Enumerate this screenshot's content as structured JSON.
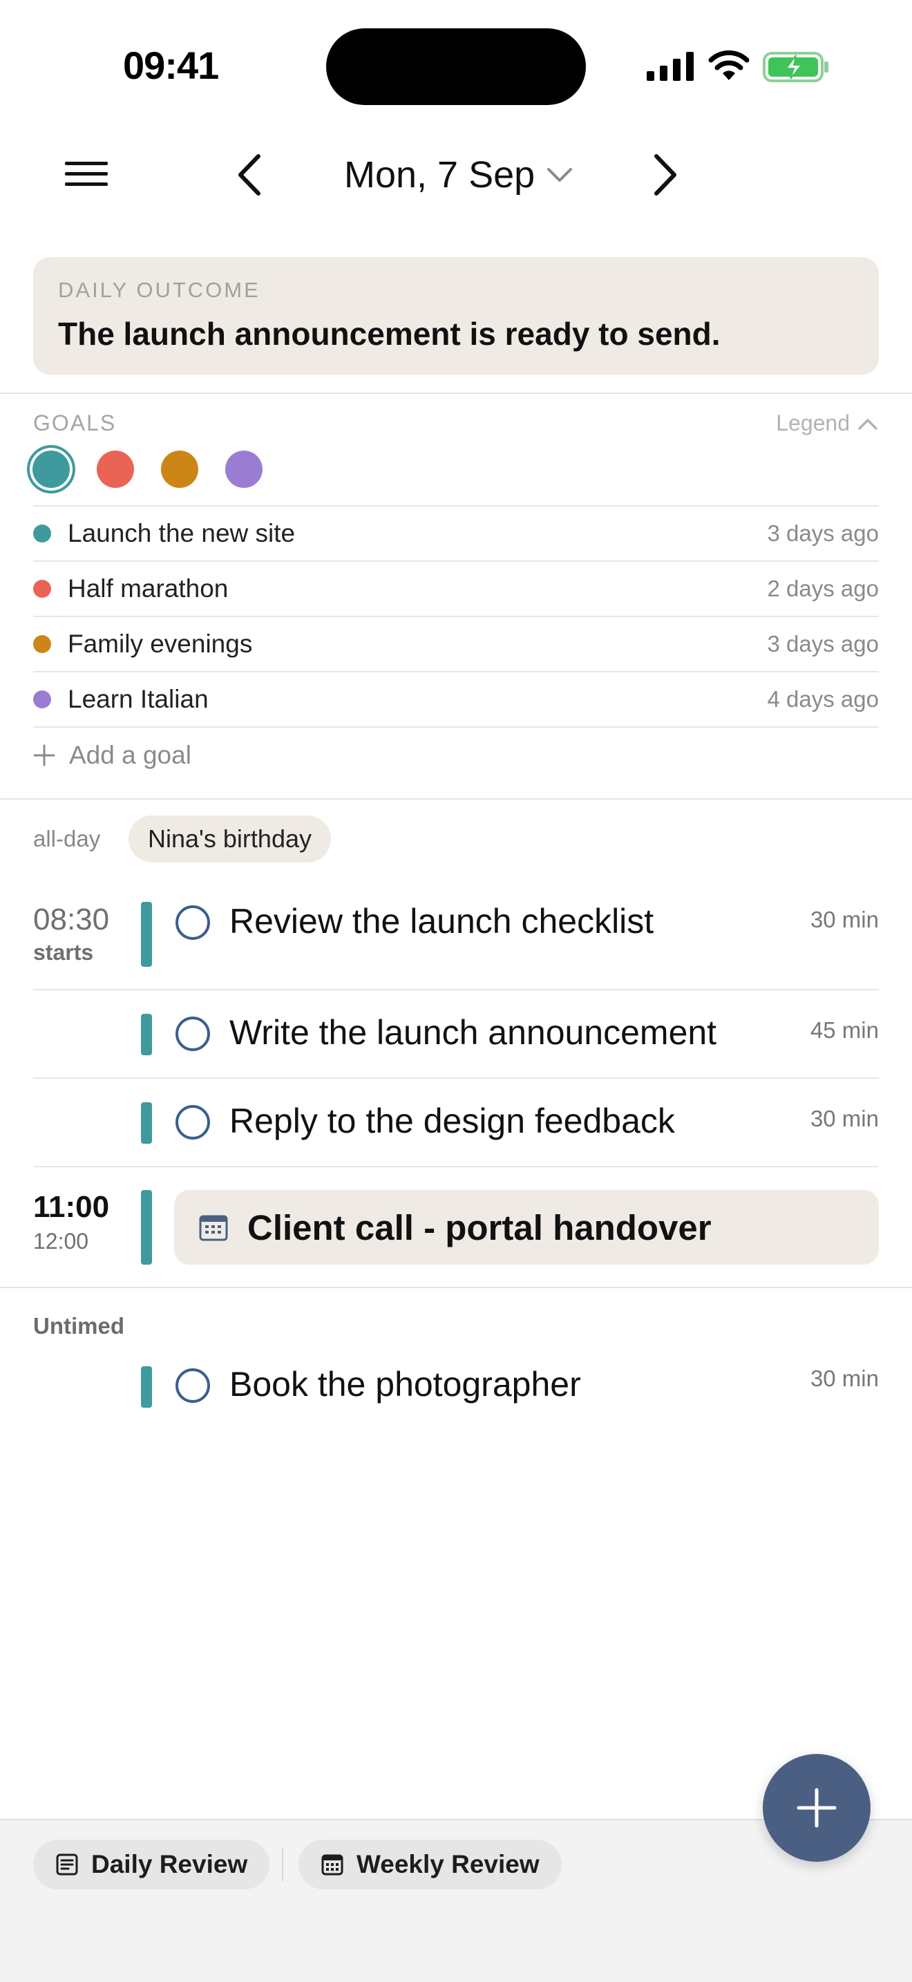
{
  "status_bar": {
    "time": "09:41"
  },
  "header": {
    "date": "Mon, 7 Sep"
  },
  "daily_outcome": {
    "label": "DAILY OUTCOME",
    "text": "The launch announcement is ready to send."
  },
  "goals": {
    "label": "GOALS",
    "legend_label": "Legend",
    "items": [
      {
        "name": "Launch the new site",
        "ago": "3 days ago",
        "color": "#3f9a9e"
      },
      {
        "name": "Half marathon",
        "ago": "2 days ago",
        "color": "#ea6456"
      },
      {
        "name": "Family evenings",
        "ago": "3 days ago",
        "color": "#cc8618"
      },
      {
        "name": "Learn Italian",
        "ago": "4 days ago",
        "color": "#9a7dd3"
      }
    ],
    "add_label": "Add a goal"
  },
  "allday": {
    "label": "all-day",
    "event": "Nina's birthday"
  },
  "schedule": {
    "block1": {
      "time": "08:30",
      "sub": "starts",
      "tasks": [
        {
          "title": "Review the launch checklist",
          "duration": "30 min"
        },
        {
          "title": "Write the launch announcement",
          "duration": "45 min"
        },
        {
          "title": "Reply to the design feedback",
          "duration": "30 min"
        }
      ]
    },
    "event": {
      "start": "11:00",
      "end": "12:00",
      "title": "Client call - portal handover"
    },
    "untimed": {
      "label": "Untimed",
      "tasks": [
        {
          "title": "Book the photographer",
          "duration": "30 min"
        }
      ]
    }
  },
  "bottom": {
    "daily_review": "Daily Review",
    "weekly_review": "Weekly Review"
  },
  "accent": {
    "task_bar": "#3f9a9e",
    "fab": "#4a5f82",
    "circle": "#3a5f8f"
  }
}
